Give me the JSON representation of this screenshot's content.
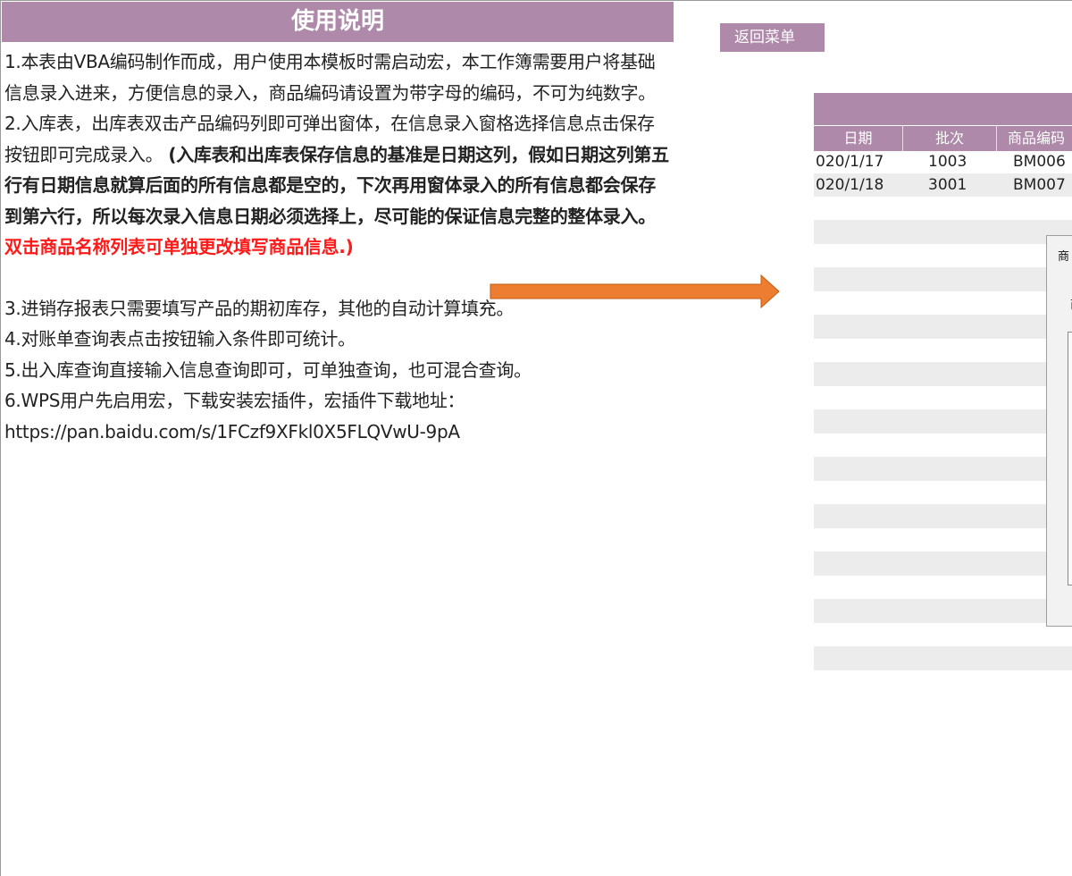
{
  "help": {
    "title": "使用说明",
    "p1": "1.本表由VBA编码制作而成，用户使用本模板时需启动宏，本工作簿需要用户将基础信息录入进来，方便信息的录入，商品编码请设置为带字母的编码，不可为纯数字。",
    "p2_normal": "2.入库表，出库表双击产品编码列即可弹出窗体，在信息录入窗格选择信息点击保存按钮即可完成录入。 ",
    "p2_bold": "(入库表和出库表保存信息的基准是日期这列，假如日期这列第五行有日期信息就算后面的所有信息都是空的，下次再用窗体录入的所有信息都会保存到第六行，所以每次录入信息日期必须选择上，尽可能的保证信息完整的整体录入。",
    "p2_red": "双击商品名称列表可单独更改填写商品信息.)",
    "p3": "3.进销存报表只需要填写产品的期初库存，其他的自动计算填充。",
    "p4": "4.对账单查询表点击按钮输入条件即可统计。",
    "p5": "5.出入库查询直接输入信息查询即可，可单独查询，也可混合查询。",
    "p6": "6.WPS用户先启用宏，下载安装宏插件，宏插件下载地址：",
    "link": "https://pan.baidu.com/s/1FCzf9XFkl0X5FLQVwU-9pA"
  },
  "back_button": {
    "label": "返回菜单"
  },
  "sheet": {
    "headers": [
      "日期",
      "批次",
      "商品编码"
    ],
    "rows": [
      {
        "date": "020/1/17",
        "batch": "1003",
        "code": "BM006"
      },
      {
        "date": "020/1/18",
        "batch": "3001",
        "code": "BM007"
      }
    ]
  },
  "dialog": {
    "title": "商",
    "label": "商"
  },
  "colors": {
    "accent": "#ae89a9",
    "arrow": "#ed7d31",
    "red_text": "#ff1a1a",
    "stripe": "#ececec"
  }
}
